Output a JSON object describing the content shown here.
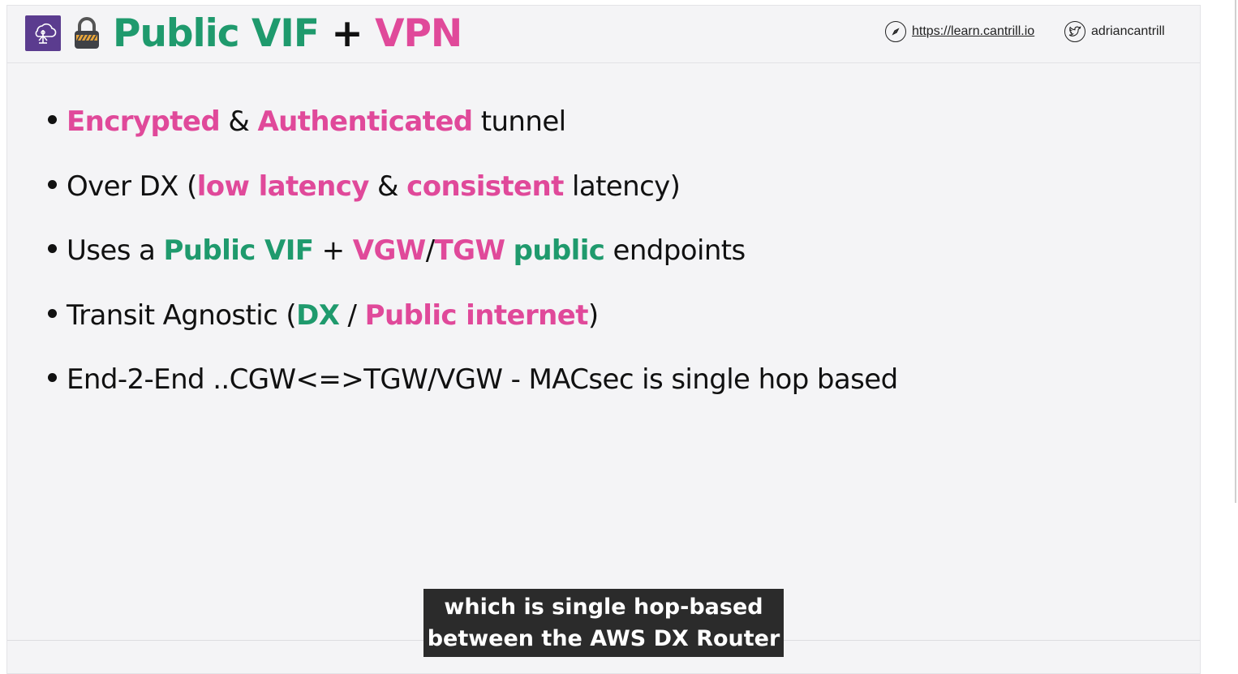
{
  "header": {
    "logo_icon": "aws-direct-connect-icon",
    "lock_icon": "padlock-icon",
    "title": [
      {
        "text": "Public VIF",
        "style": "green"
      },
      {
        "text": " + ",
        "style": "black"
      },
      {
        "text": "VPN",
        "style": "pink"
      }
    ],
    "url_icon": "compass-icon",
    "url_text": "https://learn.cantrill.io",
    "twitter_icon": "twitter-icon",
    "twitter_handle": "adriancantrill"
  },
  "bullets": [
    {
      "parts": [
        {
          "text": "Encrypted",
          "style": "pink"
        },
        {
          "text": " & ",
          "style": "plain"
        },
        {
          "text": "Authenticated",
          "style": "pink"
        },
        {
          "text": " tunnel",
          "style": "plain"
        }
      ]
    },
    {
      "parts": [
        {
          "text": "Over DX (",
          "style": "plain"
        },
        {
          "text": "low latency",
          "style": "pink"
        },
        {
          "text": " & ",
          "style": "plain"
        },
        {
          "text": "consistent",
          "style": "pink"
        },
        {
          "text": " latency)",
          "style": "plain"
        }
      ]
    },
    {
      "parts": [
        {
          "text": "Uses a ",
          "style": "plain"
        },
        {
          "text": "Public VIF",
          "style": "green"
        },
        {
          "text": " + ",
          "style": "plain"
        },
        {
          "text": "VGW",
          "style": "pink"
        },
        {
          "text": "/",
          "style": "plain"
        },
        {
          "text": "TGW",
          "style": "pink"
        },
        {
          "text": " ",
          "style": "plain"
        },
        {
          "text": "public",
          "style": "green"
        },
        {
          "text": " endpoints",
          "style": "plain"
        }
      ]
    },
    {
      "parts": [
        {
          "text": "Transit Agnostic (",
          "style": "plain"
        },
        {
          "text": "DX",
          "style": "green"
        },
        {
          "text": " / ",
          "style": "plain"
        },
        {
          "text": "Public internet",
          "style": "pink"
        },
        {
          "text": ")",
          "style": "plain"
        }
      ]
    },
    {
      "parts": [
        {
          "text": "End-2-End ..CGW<=>TGW/VGW - MACsec is single hop based",
          "style": "plain"
        }
      ]
    }
  ],
  "caption": {
    "line1": "which is single hop-based",
    "line2": "between the AWS DX Router"
  },
  "colors": {
    "green": "#1f9a6d",
    "pink": "#e0499a",
    "logo_bg": "#5b3c8f",
    "caption_bg": "#2b2b2b"
  }
}
